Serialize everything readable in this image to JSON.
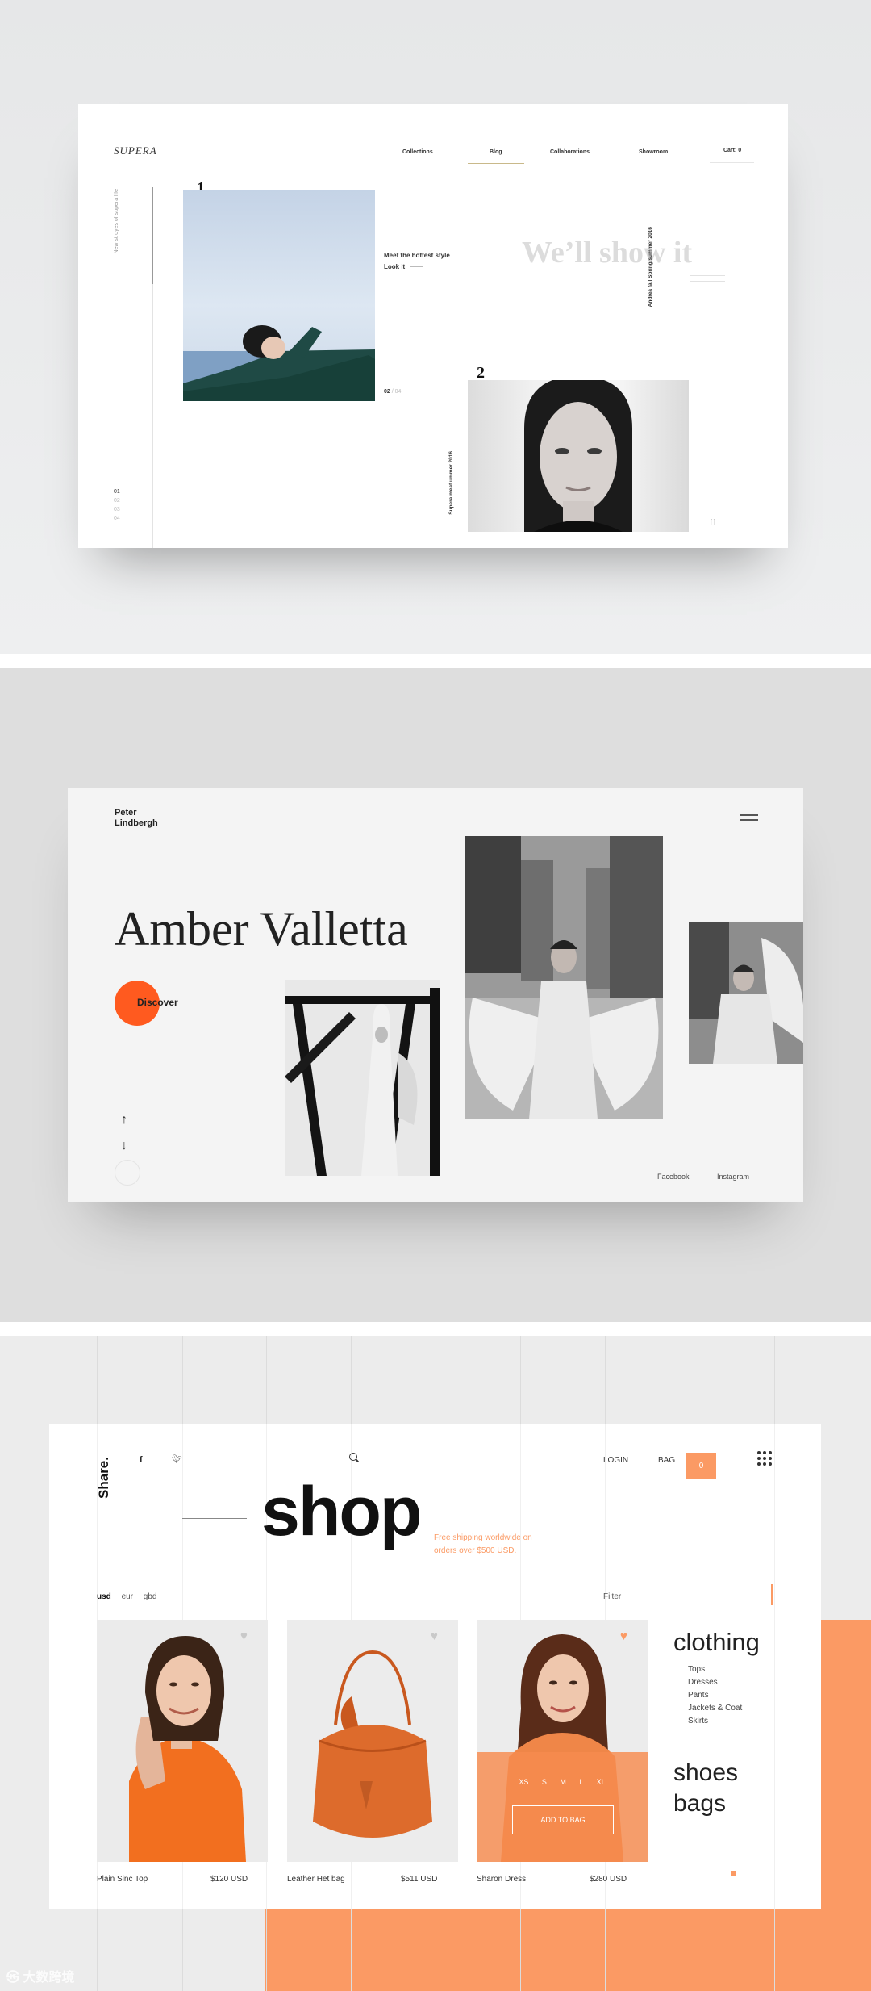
{
  "section1": {
    "logo": "SUPERA",
    "nav": [
      {
        "label": "Collections"
      },
      {
        "label": "Blog",
        "active": true
      },
      {
        "label": "Collaborations"
      },
      {
        "label": "Showroom"
      }
    ],
    "cart": "Cart: 0",
    "side_tagline": "New stroyes of supera life",
    "slide_numbers": [
      "01",
      "02",
      "03",
      "04"
    ],
    "item1_number": "1",
    "item1_title": "Meet the hottest style",
    "item1_link": "Look it",
    "pager_current": "02",
    "pager_separator": "/",
    "pager_total": "04",
    "headline": "We’ll show it",
    "vertical_caption_right": "Andrea fall Spring/summer 2016",
    "item2_number": "2",
    "vertical_caption_left": "Supera meat ummer 2016",
    "accent_color": "#c9b98a"
  },
  "section2": {
    "brand_line1": "Peter",
    "brand_line2": "Lindbergh",
    "title": "Amber Valletta",
    "discover_label": "Discover",
    "social_links": [
      "Facebook",
      "Instagram"
    ],
    "accent_color": "#ff5a1f"
  },
  "section3": {
    "share_label": "Share.",
    "social_icons": [
      "facebook-icon",
      "twitter-icon"
    ],
    "login_label": "LOGIN",
    "bag_label": "BAG",
    "bag_count": "0",
    "heading": "shop",
    "shipping_note_line1": "Free shipping  worldwide on",
    "shipping_note_line2": "orders over $500 USD.",
    "currencies": [
      "usd",
      "eur",
      "gbd"
    ],
    "active_currency": "usd",
    "filter_label": "Filter",
    "products": [
      {
        "name": "Plain Sinc Top",
        "price": "$120 USD",
        "favorited": false
      },
      {
        "name": "Leather Het bag",
        "price": "$511 USD",
        "favorited": false
      },
      {
        "name": "Sharon Dress",
        "price": "$280 USD",
        "favorited": true
      }
    ],
    "sizes": [
      "XS",
      "S",
      "M",
      "L",
      "XL"
    ],
    "add_to_bag_label": "ADD TO BAG",
    "category_title": "clothing",
    "subcategories": [
      "Tops",
      "Dresses",
      "Pants",
      "Jackets & Coat",
      "Skirts"
    ],
    "other_categories": [
      "shoes",
      "bags"
    ],
    "accent_color": "#fb9a64"
  },
  "watermark": "大数跨境"
}
